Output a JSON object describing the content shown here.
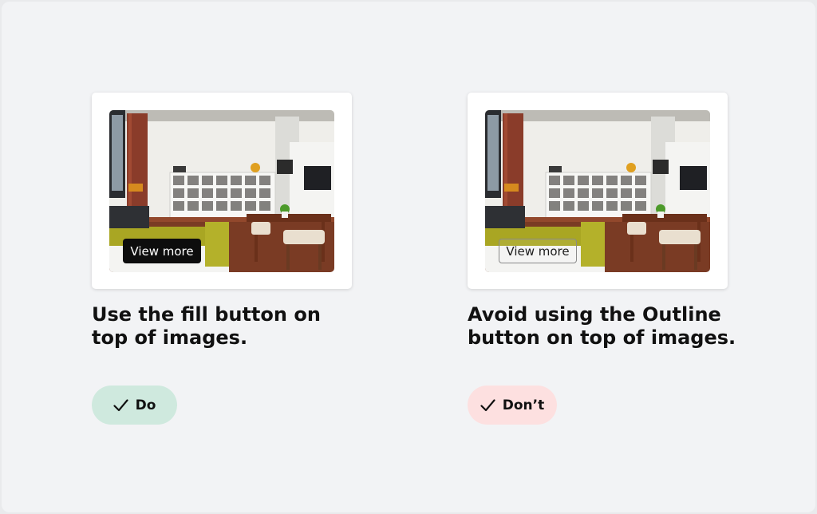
{
  "left_example": {
    "button_label": "View more",
    "caption": "Use the fill button on top of images.",
    "badge_label": "Do",
    "badge_color": "#cfe9de"
  },
  "right_example": {
    "button_label": "View more",
    "caption": "Avoid using  the Outline button on top of images.",
    "badge_label": "Don’t",
    "badge_color": "#fde0e0"
  },
  "icons": {
    "badge": "check-icon"
  },
  "colors": {
    "fill_button": "#0d0d0d",
    "outline_button_border": "#8a8a8a",
    "background": "#f2f3f5"
  }
}
